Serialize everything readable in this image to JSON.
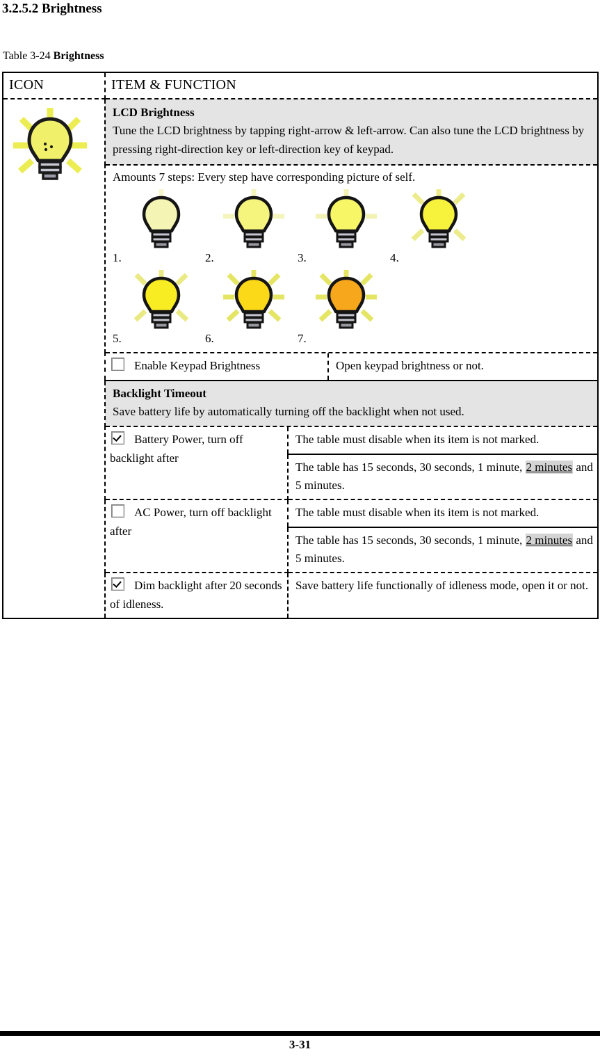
{
  "document": {
    "heading": "3.2.5.2 Brightness",
    "caption_prefix": "Table 3-24 ",
    "caption_bold": "Brightness",
    "page_number": "3-31"
  },
  "table": {
    "headers": {
      "icon": "ICON",
      "item_function": "ITEM & FUNCTION"
    },
    "icon_name": "lightbulb-bright-icon",
    "lcd_section": {
      "title": "LCD Brightness",
      "body": "Tune the LCD brightness by tapping right-arrow & left-arrow. Can also tune the LCD brightness by pressing right-direction key or left-direction key of keypad."
    },
    "steps_section": {
      "intro": "Amounts 7 steps: Every step have corresponding picture of self.",
      "steps": [
        {
          "num": "1.",
          "level": 1
        },
        {
          "num": "2.",
          "level": 2
        },
        {
          "num": "3.",
          "level": 3
        },
        {
          "num": "4.",
          "level": 4
        },
        {
          "num": "5.",
          "level": 5
        },
        {
          "num": "6.",
          "level": 6
        },
        {
          "num": "7.",
          "level": 7
        }
      ]
    },
    "keypad_row": {
      "checkbox_checked": false,
      "label": "Enable Keypad Brightness",
      "description": "Open keypad brightness or not."
    },
    "backlight_section": {
      "title": "Backlight Timeout",
      "body": "Save battery life by automatically turning off the backlight when not used."
    },
    "battery_row": {
      "checkbox_checked": true,
      "label": "Battery Power, turn off backlight after",
      "desc_1": "The table must disable when its item is not marked.",
      "desc_2_pre": "The table has 15 seconds, 30 seconds, 1 minute, ",
      "desc_2_highlight": "2 minutes",
      "desc_2_post": " and 5 minutes."
    },
    "ac_row": {
      "checkbox_checked": false,
      "label": "AC Power, turn off backlight after",
      "desc_1": "The table must disable when its item is not marked.",
      "desc_2_pre": "The table has 15 seconds, 30 seconds, 1 minute, ",
      "desc_2_highlight": "2 minutes",
      "desc_2_post": " and 5 minutes."
    },
    "dim_row": {
      "checkbox_checked": true,
      "label": "Dim backlight after 20 seconds of idleness.",
      "description": "Save battery life functionally of idleness mode, open it or not."
    }
  },
  "colors": {
    "shade": "#e4e4e4",
    "highlight": "#d4d4d4",
    "bulb_glass_1": "#f2f2a8",
    "bulb_glass_7": "#f5a623",
    "ray": "#e8e85a"
  }
}
